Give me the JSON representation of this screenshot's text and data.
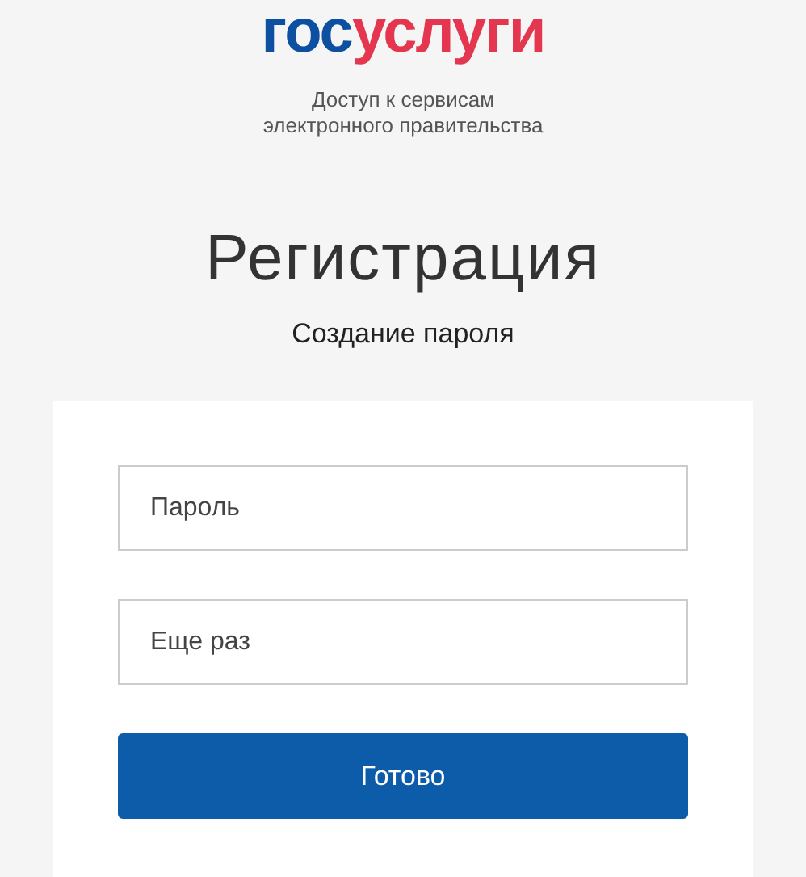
{
  "logo": {
    "parts": [
      {
        "text": "гос",
        "color": "#0d4fa0"
      },
      {
        "text": "услуги",
        "color": "#e4374f"
      }
    ]
  },
  "tagline": [
    "Доступ к сервисам",
    "электронного правительства"
  ],
  "title": "Регистрация",
  "subtitle": "Создание пароля",
  "form": {
    "fields": [
      {
        "placeholder": "Пароль"
      },
      {
        "placeholder": "Еще раз"
      }
    ],
    "submit": "Готово"
  }
}
